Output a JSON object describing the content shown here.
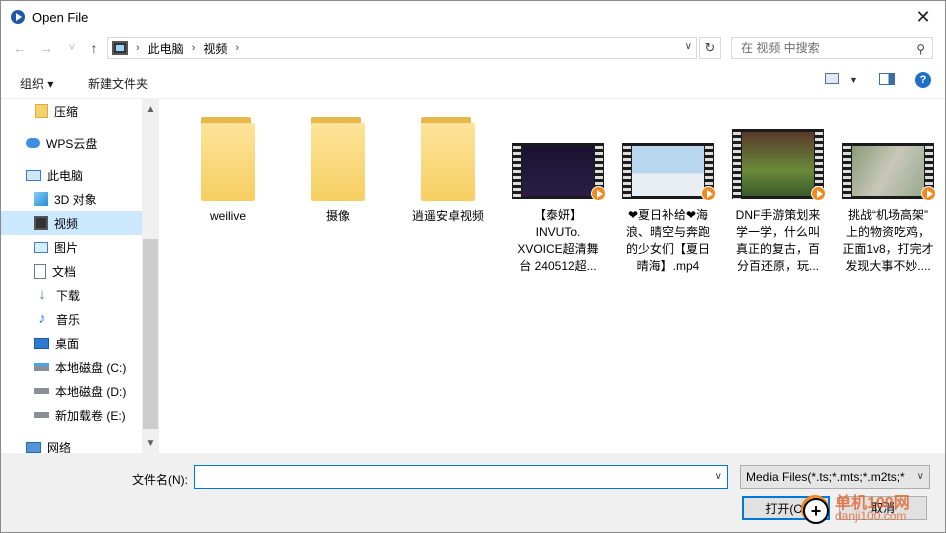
{
  "window": {
    "title": "Open File",
    "close_glyph": "✕"
  },
  "nav": {
    "back_glyph": "←",
    "forward_glyph": "→",
    "recent_glyph": "˅",
    "up_glyph": "↑",
    "breadcrumb": [
      "此电脑",
      "视频"
    ],
    "search_placeholder": "在 视频 中搜索"
  },
  "toolbar": {
    "organize_label": "组织 ▾",
    "new_folder_label": "新建文件夹"
  },
  "sidebar": {
    "items": [
      {
        "label": "压缩",
        "icon": "folder-icon"
      },
      {
        "label": "WPS云盘",
        "icon": "cloud-icon"
      },
      {
        "label": "此电脑",
        "icon": "computer-icon"
      },
      {
        "label": "3D 对象",
        "icon": "cube-icon"
      },
      {
        "label": "视频",
        "icon": "video-icon",
        "selected": true
      },
      {
        "label": "图片",
        "icon": "pictures-icon"
      },
      {
        "label": "文档",
        "icon": "documents-icon"
      },
      {
        "label": "下载",
        "icon": "download-icon"
      },
      {
        "label": "音乐",
        "icon": "music-icon"
      },
      {
        "label": "桌面",
        "icon": "desktop-icon"
      },
      {
        "label": "本地磁盘 (C:)",
        "icon": "drive-icon"
      },
      {
        "label": "本地磁盘 (D:)",
        "icon": "drive-icon"
      },
      {
        "label": "新加载卷 (E:)",
        "icon": "drive-icon"
      },
      {
        "label": "网络",
        "icon": "network-icon"
      }
    ]
  },
  "files": {
    "folders": [
      "weilive",
      "摄像",
      "逍遥安卓视频"
    ],
    "videos": [
      {
        "lines": [
          "【泰妍】",
          "INVUTo.",
          "XVOICE超清舞",
          "台 240512超..."
        ]
      },
      {
        "lines": [
          "❤夏日补给❤海",
          "浪、晴空与奔跑",
          "的少女们【夏日",
          "晴海】.mp4"
        ]
      },
      {
        "lines": [
          "DNF手游策划来",
          "学一学，什么叫",
          "真正的复古，百",
          "分百还原，玩..."
        ]
      },
      {
        "lines": [
          "挑战“机场高架”",
          "上的物资吃鸡，",
          "正面1v8，打完才",
          "发现大事不妙...."
        ]
      }
    ]
  },
  "bottom": {
    "filename_label": "文件名(N):",
    "filename_value": "",
    "filter_value": "Media Files(*.ts;*.mts;*.m2ts;*",
    "open_label": "打开(O)",
    "cancel_label": "取消"
  },
  "watermark": {
    "site_name": "单机100网",
    "url": "danji100.com"
  }
}
